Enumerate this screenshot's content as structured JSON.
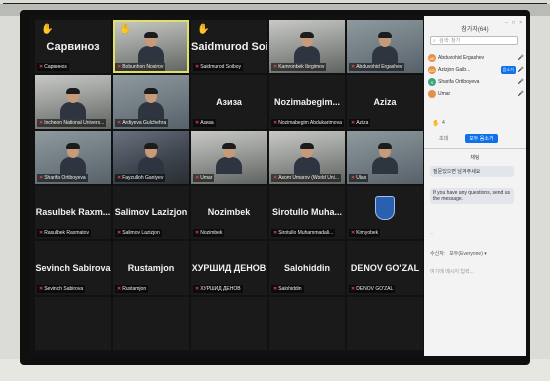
{
  "panel": {
    "title": "참가자(64)",
    "search_placeholder": "검색: 참가",
    "participants": [
      {
        "initials": "AE",
        "color": "#e5904a",
        "name": "Abduvohid Ergashev"
      },
      {
        "initials": "AG",
        "color": "#e5904a",
        "name": "Azizjon Gaib...",
        "action": "음소거"
      },
      {
        "initials": "S",
        "color": "#3aa57a",
        "name": "Sharifa Ortiboyeva"
      },
      {
        "initials": "",
        "color": "#e5904a",
        "name": "Umar"
      }
    ],
    "raised_count": "4",
    "btn_mute_all": "초대",
    "btn_more": "모두 음소거",
    "chat_title": "채팅",
    "messages": [
      "질문있으면 남겨주세요",
      "If you have any questions, send us the message."
    ],
    "chat_note": "...",
    "recipient_label": "수신자:",
    "recipient_value": "모두(Everyone) ▾",
    "input_placeholder": "여기에 메시지 입력..."
  },
  "tiles": [
    {
      "name": "Сарвиноз",
      "label": "Сарвиноз",
      "video": false,
      "hand": true,
      "big": true
    },
    {
      "name": "",
      "label": "Bobunhon Nosirov",
      "video": true,
      "variant": "v2",
      "active": true,
      "hand": true
    },
    {
      "name": "Saidmurod Soib...",
      "label": "Saidmurod Soiboy",
      "video": false,
      "hand": true,
      "big": true
    },
    {
      "name": "",
      "label": "Kamronbek Ibrgimov",
      "video": true,
      "variant": "v2"
    },
    {
      "name": "",
      "label": "Abduvohid Ergashev",
      "video": true,
      "variant": "v3"
    },
    {
      "name": "",
      "label": "Incheon National Univers...",
      "video": true,
      "variant": "v2"
    },
    {
      "name": "",
      "label": "Ardiyeva Gulchehra",
      "video": true,
      "variant": "v3"
    },
    {
      "name": "Азиза",
      "label": "Азиза",
      "video": false
    },
    {
      "name": "Nozimabegim...",
      "label": "Nozimabegim Abdukarimova",
      "video": false
    },
    {
      "name": "Aziza",
      "label": "Aziza",
      "video": false
    },
    {
      "name": "",
      "label": "Sharifa Ortiboyeva",
      "video": true,
      "variant": "v3"
    },
    {
      "name": "",
      "label": "Fayzulloh Ganiyev",
      "video": true
    },
    {
      "name": "",
      "label": "Umar",
      "video": true,
      "variant": "v2"
    },
    {
      "name": "",
      "label": "Asom Umarov (World Uni...",
      "video": true,
      "variant": "v2"
    },
    {
      "name": "",
      "label": "Ulas",
      "video": true,
      "variant": "v3"
    },
    {
      "name": "Rasulbek Raxm...",
      "label": "Rasulbek Raxmatov",
      "video": false
    },
    {
      "name": "Salimov Lazizjon",
      "label": "Salimov Lazizjon",
      "video": false
    },
    {
      "name": "Nozimbek",
      "label": "Nozimbek",
      "video": false
    },
    {
      "name": "Sirotullo Muha...",
      "label": "Sirotullo Muhammadali...",
      "video": false
    },
    {
      "name": "",
      "label": "Kimyobek",
      "video": false,
      "emblem": true
    },
    {
      "name": "Sevinch Sabirova",
      "label": "Sevinch Sabirova",
      "video": false
    },
    {
      "name": "Rustamjon",
      "label": "Rustamjon",
      "video": false
    },
    {
      "name": "ХУРШИД ДЕНОВ",
      "label": "ХУРШИД ДЕНОВ",
      "video": false
    },
    {
      "name": "Salohiddin",
      "label": "Salohiddin",
      "video": false
    },
    {
      "name": "DENOV GO'ZAL",
      "label": "DENOV GO'ZAL",
      "video": false
    },
    {
      "name": "",
      "label": "",
      "video": false,
      "blank": true
    },
    {
      "name": "",
      "label": "",
      "video": false,
      "blank": true
    },
    {
      "name": "",
      "label": "",
      "video": false,
      "blank": true
    },
    {
      "name": "",
      "label": "",
      "video": false,
      "blank": true
    },
    {
      "name": "",
      "label": "",
      "video": false,
      "blank": true
    }
  ]
}
